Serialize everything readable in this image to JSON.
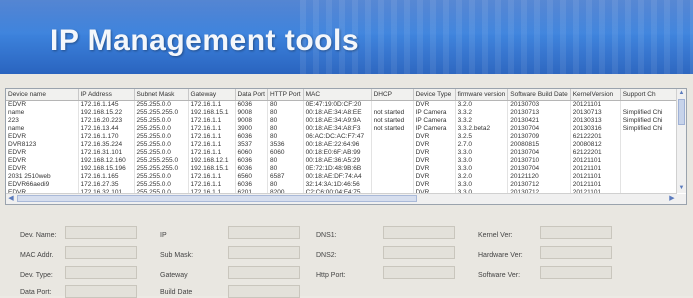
{
  "app": {
    "title": "IP Management tools"
  },
  "grid": {
    "columns": [
      "Device name",
      "IP Address",
      "Subnet Mask",
      "Gateway",
      "Data Port",
      "HTTP Port",
      "MAC",
      "DHCP",
      "Device Type",
      "firmware version",
      "Software Build Date",
      "KernelVersion",
      "Support Ch"
    ],
    "rows": [
      [
        "EDVR",
        "172.16.1.145",
        "255.255.0.0",
        "172.16.1.1",
        "6036",
        "80",
        "0E:47:19:0D:CF:20",
        "",
        "DVR",
        "3.2.0",
        "20130703",
        "20121101",
        ""
      ],
      [
        "name",
        "192.168.15.22",
        "255.255.255.0",
        "192.168.15.1",
        "9008",
        "80",
        "00:18:AE:34:A8:EE",
        "not started",
        "IP Camera",
        "3.3.2",
        "20130713",
        "20130713",
        "Simplified Chi"
      ],
      [
        "223",
        "172.16.20.223",
        "255.255.0.0",
        "172.16.1.1",
        "9008",
        "80",
        "00:18:AE:34:A9:9A",
        "not started",
        "IP Camera",
        "3.3.2",
        "20130421",
        "20130313",
        "Simplified Chi"
      ],
      [
        "name",
        "172.16.13.44",
        "255.255.0.0",
        "172.16.1.1",
        "3900",
        "80",
        "00:18:AE:34:A8:F3",
        "not started",
        "IP Camera",
        "3.3.2.beta2",
        "20130704",
        "20130316",
        "Simplified Chi"
      ],
      [
        "EDVR",
        "172.16.1.170",
        "255.255.0.0",
        "172.16.1.1",
        "6036",
        "80",
        "06:AC:DC:AC:F7:47",
        "",
        "DVR",
        "3.2.5",
        "20130709",
        "62122201",
        ""
      ],
      [
        "DVR8123",
        "172.16.35.224",
        "255.255.0.0",
        "172.16.1.1",
        "3537",
        "3536",
        "00:18:AE:22:64:96",
        "",
        "DVR",
        "2.7.0",
        "20080815",
        "20080812",
        ""
      ],
      [
        "EDVR",
        "172.16.31.101",
        "255.255.0.0",
        "172.16.1.1",
        "6060",
        "6060",
        "00:18:E0:6F:AB:99",
        "",
        "DVR",
        "3.3.0",
        "20130704",
        "62122201",
        ""
      ],
      [
        "EDVR",
        "192.168.12.160",
        "255.255.255.0",
        "192.168.12.1",
        "6036",
        "80",
        "00:18:AE:36:A5:29",
        "",
        "DVR",
        "3.3.0",
        "20130710",
        "20121101",
        ""
      ],
      [
        "EDVR",
        "192.168.15.196",
        "255.255.255.0",
        "192.168.15.1",
        "6036",
        "80",
        "0E:72:1D:48:9B:6B",
        "",
        "DVR",
        "3.3.0",
        "20130704",
        "20121101",
        ""
      ],
      [
        "2031 2510web",
        "172.16.1.165",
        "255.255.0.0",
        "172.16.1.1",
        "6560",
        "6587",
        "00:18:AE:DF:74:A4",
        "",
        "DVR",
        "3.2.0",
        "20121120",
        "20121101",
        ""
      ],
      [
        "EDVR66aedi9",
        "172.16.27.35",
        "255.255.0.0",
        "172.16.1.1",
        "6036",
        "80",
        "32:14:3A:1D:46:56",
        "",
        "DVR",
        "3.3.0",
        "20130712",
        "20121101",
        ""
      ],
      [
        "EDVR",
        "172.16.32.101",
        "255.255.0.0",
        "172.16.1.1",
        "6201",
        "8200",
        "C2:C6:00:04:F4:75",
        "",
        "DVR",
        "3.3.0",
        "20130712",
        "20121101",
        ""
      ]
    ]
  },
  "details": {
    "device_name_label": "Dev. Name:",
    "mac_addr_label": "MAC Addr.",
    "dev_type_label": "Dev. Type:",
    "data_port_label": "Data Port:",
    "ip_label": "IP",
    "sub_mask_label": "Sub Mask:",
    "gateway_label": "Gateway",
    "build_date_label": "Build Date",
    "dns1_label": "DNS1:",
    "dns2_label": "DNS2:",
    "http_port_label": "Http Port:",
    "kernel_ver_label": "Kernel Ver:",
    "hardware_ver_label": "Hardware Ver:",
    "software_ver_label": "Software Ver:"
  },
  "icons": {
    "scroll_up": "up-arrow-icon",
    "scroll_down": "down-arrow-icon",
    "scroll_left": "left-arrow-icon",
    "scroll_right": "right-arrow-icon"
  },
  "colors": {
    "banner": "#3d83dd",
    "title": "#f4f7fb",
    "panel": "#e9e7e1"
  }
}
